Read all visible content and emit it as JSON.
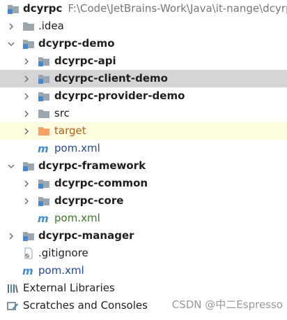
{
  "tree": {
    "root": {
      "label": "dcyrpc",
      "path": "F:\\Code\\JetBrains-Work\\Java\\it-nange\\dcyrpc"
    },
    "idea": {
      "label": ".idea"
    },
    "demo": {
      "label": "dcyrpc-demo"
    },
    "demo_api": {
      "label": "dcyrpc-api"
    },
    "demo_client": {
      "label": "dcyrpc-client-demo"
    },
    "demo_provider": {
      "label": "dcyrpc-provider-demo"
    },
    "demo_src": {
      "label": "src"
    },
    "demo_target": {
      "label": "target"
    },
    "demo_pom": {
      "label": "pom.xml"
    },
    "framework": {
      "label": "dcyrpc-framework"
    },
    "fw_common": {
      "label": "dcyrpc-common"
    },
    "fw_core": {
      "label": "dcyrpc-core"
    },
    "fw_pom": {
      "label": "pom.xml"
    },
    "manager": {
      "label": "dcyrpc-manager"
    },
    "gitignore": {
      "label": ".gitignore"
    },
    "root_pom": {
      "label": "pom.xml"
    },
    "external_libraries": {
      "label": "External Libraries"
    },
    "scratches": {
      "label": "Scratches and Consoles"
    }
  },
  "watermark": "CSDN @中二Espresso",
  "colors": {
    "selection": "#d5d5d5",
    "excluded_highlight": "#fdfbe0",
    "folder_gray": "#9aa7b0",
    "module_blue": "#3d8bd9",
    "excluded_folder": "#f4a261"
  }
}
